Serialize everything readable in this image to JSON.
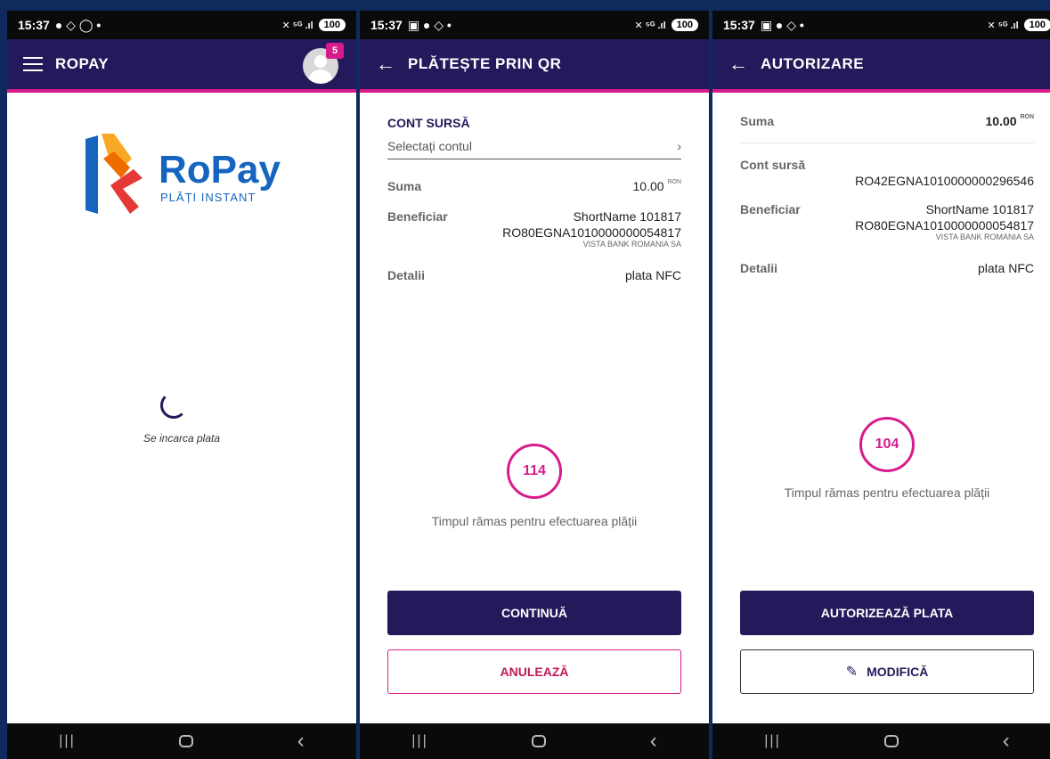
{
  "screens": [
    {
      "status": {
        "time": "15:37",
        "battery": "100"
      },
      "appbar": {
        "title": "ROPAY",
        "badge": "5"
      },
      "logo": {
        "name": "RoPay",
        "subtitle": "PLĂȚI INSTANT"
      },
      "loading_text": "Se incarca plata"
    },
    {
      "status": {
        "time": "15:37",
        "battery": "100"
      },
      "appbar": {
        "title": "PLĂTEȘTE PRIN QR"
      },
      "source_title": "CONT SURSĂ",
      "source_placeholder": "Selectați contul",
      "amount_label": "Suma",
      "amount_value": "10.00",
      "currency": "RON",
      "beneficiary_label": "Beneficiar",
      "beneficiary_name": "ShortName 101817",
      "beneficiary_iban": "RO80EGNA1010000000054817",
      "beneficiary_bank": "VISTA BANK ROMANIA SA",
      "details_label": "Detalii",
      "details_value": "plata NFC",
      "timer_value": "114",
      "timer_text": "Timpul rămas pentru efectuarea plății",
      "primary_button": "CONTINUĂ",
      "secondary_button": "ANULEAZĂ"
    },
    {
      "status": {
        "time": "15:37",
        "battery": "100"
      },
      "appbar": {
        "title": "AUTORIZARE"
      },
      "amount_label": "Suma",
      "amount_value": "10.00",
      "currency": "RON",
      "source_label": "Cont sursă",
      "source_iban": "RO42EGNA1010000000296546",
      "beneficiary_label": "Beneficiar",
      "beneficiary_name": "ShortName 101817",
      "beneficiary_iban": "RO80EGNA1010000000054817",
      "beneficiary_bank": "VISTA BANK ROMANIA SA",
      "details_label": "Detalii",
      "details_value": "plata NFC",
      "timer_value": "104",
      "timer_text": "Timpul rămas pentru efectuarea plății",
      "primary_button": "AUTORIZEAZĂ PLATA",
      "secondary_button": "MODIFICĂ"
    }
  ],
  "colors": {
    "brand_navy": "#221a5a",
    "accent_magenta": "#d81b8c",
    "logo_blue": "#1565c0"
  },
  "icons": [
    "menu-icon",
    "avatar-icon",
    "back-arrow-icon",
    "chevron-right-icon",
    "pencil-icon",
    "spinner-icon"
  ]
}
